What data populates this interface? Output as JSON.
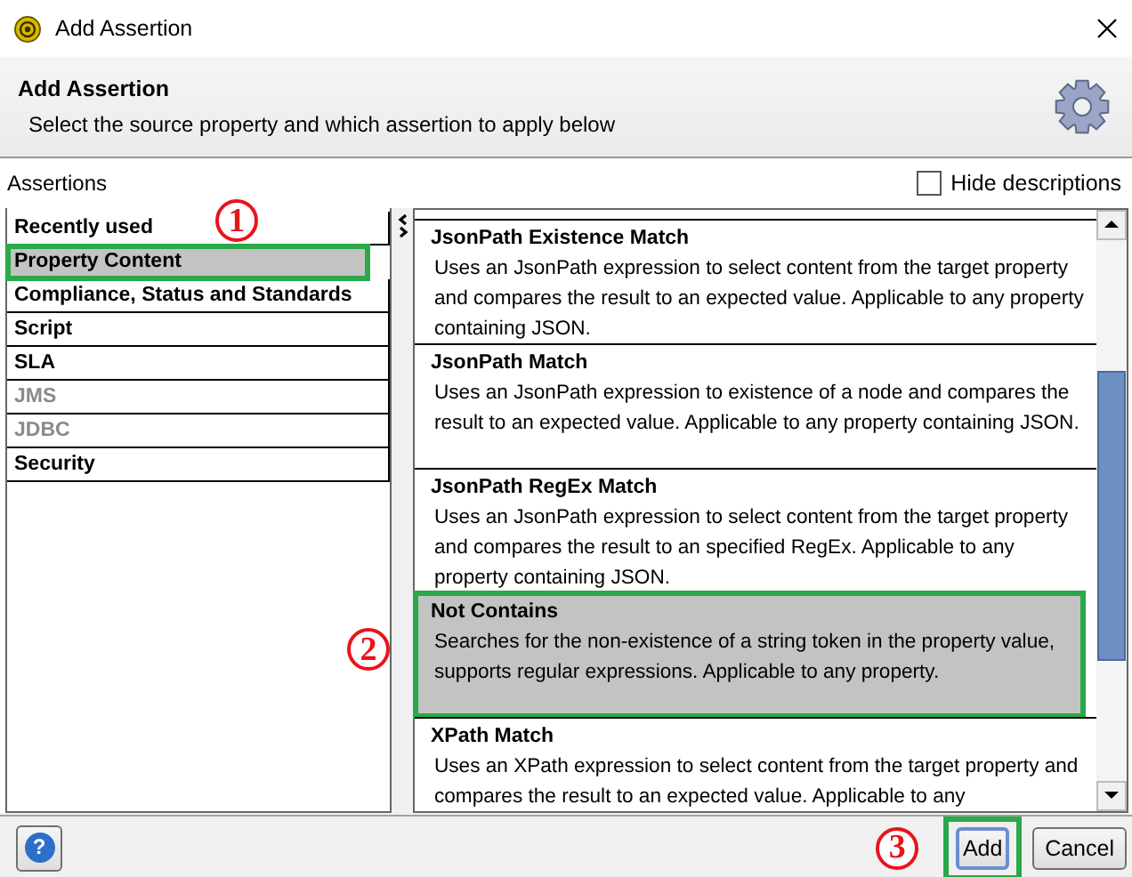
{
  "window": {
    "title": "Add Assertion"
  },
  "header": {
    "title": "Add Assertion",
    "subtitle": "Select the source property and which assertion to apply below"
  },
  "assertions_label": "Assertions",
  "hide_descriptions": {
    "label": "Hide descriptions",
    "checked": false
  },
  "categories": [
    {
      "label": "Recently used",
      "selected": false,
      "disabled": false,
      "highlighted": false
    },
    {
      "label": "Property Content",
      "selected": true,
      "disabled": false,
      "highlighted": true,
      "marker": "1"
    },
    {
      "label": "Compliance, Status and Standards",
      "selected": false,
      "disabled": false,
      "highlighted": false
    },
    {
      "label": "Script",
      "selected": false,
      "disabled": false,
      "highlighted": false
    },
    {
      "label": "SLA",
      "selected": false,
      "disabled": false,
      "highlighted": false
    },
    {
      "label": "JMS",
      "selected": false,
      "disabled": true,
      "highlighted": false
    },
    {
      "label": "JDBC",
      "selected": false,
      "disabled": true,
      "highlighted": false
    },
    {
      "label": "Security",
      "selected": false,
      "disabled": false,
      "highlighted": false
    }
  ],
  "assertions": [
    {
      "name": "JsonPath Existence Match",
      "description": "Uses an JsonPath expression to select content from the target property and compares the result to an expected value. Applicable to any property containing JSON.",
      "selected": false,
      "highlighted": false
    },
    {
      "name": "JsonPath Match",
      "description": "Uses an JsonPath expression to existence of a node and compares the result to an expected value. Applicable to any property containing JSON.",
      "selected": false,
      "highlighted": false
    },
    {
      "name": "JsonPath RegEx Match",
      "description": "Uses an JsonPath expression to select content from the target property and compares the result to an specified RegEx. Applicable to any property containing JSON.",
      "selected": false,
      "highlighted": false
    },
    {
      "name": "Not Contains",
      "description": "Searches for the non-existence of a string token in the property value, supports regular expressions. Applicable to any property.",
      "selected": true,
      "highlighted": true,
      "marker": "2"
    },
    {
      "name": "XPath Match",
      "description": "Uses an XPath expression to select content from the target property and compares the result to an expected value. Applicable to any",
      "selected": false,
      "highlighted": false
    }
  ],
  "buttons": [
    {
      "kind": "help",
      "label": "?",
      "highlighted": false
    },
    {
      "kind": "default",
      "label": "Add",
      "highlighted": true,
      "marker": "3"
    },
    {
      "kind": "normal",
      "label": "Cancel",
      "highlighted": false
    }
  ]
}
